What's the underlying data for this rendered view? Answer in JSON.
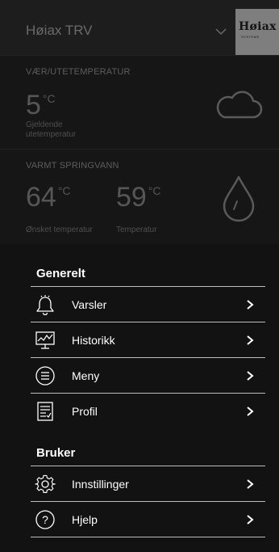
{
  "header": {
    "app_title": "Høiax TRV",
    "logo_text": "Høiax",
    "logo_subtext": "SYSTEMS"
  },
  "weather_card": {
    "title": "VÆR/UTETEMPERATUR",
    "temp_value": "5",
    "temp_unit": "°C",
    "temp_label_line1": "Gjeldende",
    "temp_label_line2": "utetemperatur",
    "icon": "cloud-icon"
  },
  "water_card": {
    "title": "VARMT SPRINGVANN",
    "desired_value": "64",
    "desired_unit": "°C",
    "desired_label": "Ønsket temperatur",
    "current_value": "59",
    "current_unit": "°C",
    "current_label": "Temperatur",
    "icon": "water-drop-icon"
  },
  "menu": {
    "sections": [
      {
        "title": "Generelt",
        "items": [
          {
            "label": "Varsler",
            "icon": "bell-icon"
          },
          {
            "label": "Historikk",
            "icon": "chart-monitor-icon"
          },
          {
            "label": "Meny",
            "icon": "list-icon"
          },
          {
            "label": "Profil",
            "icon": "document-icon"
          }
        ]
      },
      {
        "title": "Bruker",
        "items": [
          {
            "label": "Innstillinger",
            "icon": "gear-icon"
          },
          {
            "label": "Hjelp",
            "icon": "help-icon"
          }
        ]
      }
    ]
  },
  "colors": {
    "background": "#121212",
    "text": "#ffffff",
    "divider": "#bdbdbd",
    "dimmed_text": "#565656"
  }
}
